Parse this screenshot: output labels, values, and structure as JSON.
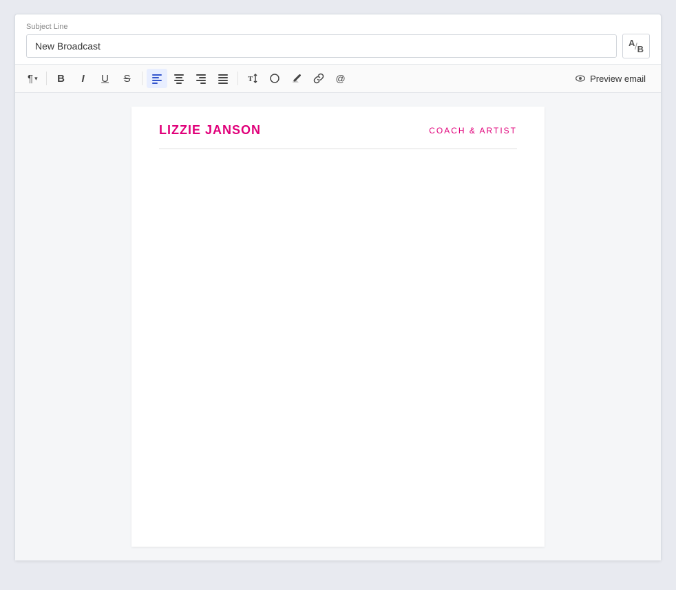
{
  "subject": {
    "label": "Subject Line",
    "value": "New Broadcast",
    "ab_label": "A/B"
  },
  "toolbar": {
    "paragraph_label": "¶",
    "bold_label": "B",
    "italic_label": "I",
    "underline_label": "U",
    "strikethrough_label": "S",
    "align_left_label": "≡",
    "align_center_label": "≡",
    "align_right_label": "≡",
    "align_justify_label": "≡",
    "font_size_label": "T↕",
    "highlight_label": "◯",
    "eraser_label": "✎",
    "link_label": "🔗",
    "mention_label": "@",
    "preview_label": "Preview email"
  },
  "email": {
    "brand_name": "LIZZIE JANSON",
    "brand_tagline": "COACH & ARTIST"
  },
  "colors": {
    "brand_pink": "#e0007a",
    "divider": "#dddddd"
  }
}
